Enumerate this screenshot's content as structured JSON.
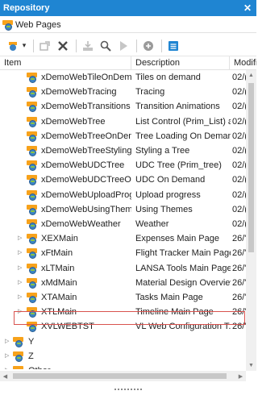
{
  "window": {
    "title": "Repository",
    "close_glyph": "✕"
  },
  "selector": {
    "value": "Web Pages",
    "dropdown_glyph": "▾",
    "icon": "web-page-icon"
  },
  "toolbar": {
    "buttons": [
      {
        "icon": "new-item-icon",
        "glyph": "▾",
        "enabled": true
      },
      {
        "icon": "move-icon",
        "enabled": false
      },
      {
        "icon": "delete-icon",
        "enabled": true
      },
      {
        "icon": "checkin-icon",
        "enabled": false
      },
      {
        "icon": "search-icon",
        "enabled": true
      },
      {
        "icon": "play-icon",
        "enabled": false
      },
      {
        "icon": "add-icon",
        "enabled": true
      },
      {
        "icon": "list-view-icon",
        "enabled": true
      }
    ]
  },
  "columns": {
    "item": "Item",
    "description": "Description",
    "modified": "Modifi"
  },
  "rows": [
    {
      "name": "xDemoWebTileOnDema...",
      "description": "Tiles on demand",
      "modified": "02/("
    },
    {
      "name": "xDemoWebTracing",
      "description": "Tracing",
      "modified": "02/("
    },
    {
      "name": "xDemoWebTransitions",
      "description": "Transition Animations",
      "modified": "02/("
    },
    {
      "name": "xDemoWebTree",
      "description": "List Control (Prim_List) a...",
      "modified": "02/("
    },
    {
      "name": "xDemoWebTreeOnDema...",
      "description": "Tree Loading On Demand",
      "modified": "02/("
    },
    {
      "name": "xDemoWebTreeStyling",
      "description": "Styling a Tree",
      "modified": "02/("
    },
    {
      "name": "xDemoWebUDCTree",
      "description": "UDC Tree (Prim_tree)",
      "modified": "02/("
    },
    {
      "name": "xDemoWebUDCTreeOn...",
      "description": "UDC On Demand",
      "modified": "02/("
    },
    {
      "name": "xDemoWebUploadProgr...",
      "description": "Upload progress",
      "modified": "02/("
    },
    {
      "name": "xDemoWebUsingThemes",
      "description": "Using Themes",
      "modified": "02/("
    },
    {
      "name": "xDemoWebWeather",
      "description": "Weather",
      "modified": "02/("
    },
    {
      "name": "XEXMain",
      "description": "Expenses Main Page",
      "modified": "26/'",
      "expandable": true
    },
    {
      "name": "xFtMain",
      "description": "Flight Tracker Main Page",
      "modified": "26/'",
      "expandable": true
    },
    {
      "name": "xLTMain",
      "description": "LANSA Tools Main Page",
      "modified": "26/'",
      "expandable": true
    },
    {
      "name": "xMdMain",
      "description": "Material Design Overview",
      "modified": "26/'",
      "expandable": true
    },
    {
      "name": "XTAMain",
      "description": "Tasks Main Page",
      "modified": "26/'",
      "expandable": true
    },
    {
      "name": "XTLMain",
      "description": "Timeline Main Page",
      "modified": "26/'",
      "expandable": true
    },
    {
      "name": "XVLWEBTST",
      "description": "VL Web Configuration T...",
      "modified": "26/'",
      "selected": true
    },
    {
      "name": "Y",
      "description": "",
      "modified": "",
      "group": true
    },
    {
      "name": "Z",
      "description": "",
      "modified": "",
      "group": true
    },
    {
      "name": "Other",
      "description": "",
      "modified": "",
      "group": true
    }
  ],
  "scroll": {
    "vertical_up": "▲",
    "vertical_down": "▼",
    "horizontal_left": "◀",
    "horizontal_right": "▶"
  },
  "expander_glyph": "▷",
  "colors": {
    "titlebar": "#1f85d2",
    "selection_border": "#d9534f",
    "icon_orange": "#f7a21b",
    "icon_blue": "#3b83c4"
  }
}
